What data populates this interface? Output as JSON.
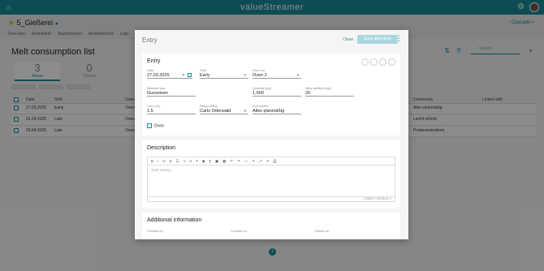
{
  "app": {
    "brand": "valueStreamer"
  },
  "workspace": {
    "title": "5_Gießerei",
    "cascade_label": "Cascade"
  },
  "nav_tabs": [
    "Overview",
    "Arbeitsfeld",
    "Maschinenen",
    "Arbeitsbericht",
    "Logs"
  ],
  "list": {
    "title": "Melt consumption list",
    "search_placeholder": "Search",
    "counters": [
      {
        "count": "3",
        "label": "Active"
      },
      {
        "count": "0",
        "label": "Closed"
      }
    ],
    "columns": [
      "Date",
      "Shift",
      "Oven",
      "Comments",
      "Linked with"
    ],
    "rows": [
      {
        "date": "27.03.2025",
        "shift": "Early",
        "oven": "Oven",
        "comment": "Alles planmäßig"
      },
      {
        "date": "01.04.2025",
        "shift": "Late",
        "oven": "Oven",
        "comment": "Leicht erhöht"
      },
      {
        "date": "03.04.2025",
        "shift": "Late",
        "oven": "Oven",
        "comment": "Probenentnahme"
      }
    ],
    "page": "1"
  },
  "modal": {
    "title": "Entry",
    "close_label": "Close",
    "save_label": "Save and close",
    "entry": {
      "heading": "Entry",
      "date": {
        "label": "Date",
        "value": "27.03.2025"
      },
      "shift": {
        "label": "Shift",
        "value": "Early"
      },
      "oven": {
        "label": "Oven no.",
        "value": "Oven 2"
      },
      "material": {
        "label": "Material type",
        "value": "Gusseisen"
      },
      "quantity": {
        "label": "Quantity (kg)",
        "value": "1,500"
      },
      "alloy": {
        "label": "Alloy addition (kg)",
        "value": "20"
      },
      "loss": {
        "label": "Loss (%)",
        "value": "1.5"
      },
      "responsible": {
        "label": "Responsible",
        "value": "Carlo Oderwald"
      },
      "comments": {
        "label": "Comments",
        "value": "Alles planmäßig"
      },
      "done_label": "Done"
    },
    "description": {
      "heading": "Description",
      "placeholder": "Start writing...",
      "footer": "CHARS: 0 WORDS: 0"
    },
    "additional": {
      "heading": "Additional information",
      "created_by": "Created by",
      "created_on": "Created on",
      "closed_on": "Closed on"
    }
  }
}
